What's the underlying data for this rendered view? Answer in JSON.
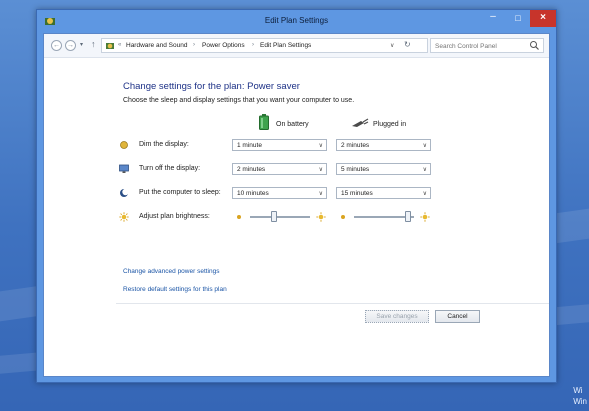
{
  "window": {
    "title": "Edit Plan Settings",
    "close_symbol": "×",
    "min_symbol": "–",
    "max_symbol": "□"
  },
  "nav": {
    "back_symbol": "←",
    "forward_symbol": "→",
    "recent_symbol": "▾",
    "up_symbol": "↑",
    "prefix_symbol": "«",
    "breadcrumbs": [
      "Hardware and Sound",
      "Power Options",
      "Edit Plan Settings"
    ],
    "breadcrumb_separator": "›",
    "dropdown_symbol": "∨",
    "refresh_symbol": "↻",
    "search_placeholder": "Search Control Panel"
  },
  "content": {
    "heading": "Change settings for the plan: Power saver",
    "subheading": "Choose the sleep and display settings that you want your computer to use.",
    "columns": {
      "battery": "On battery",
      "plugged": "Plugged in"
    },
    "rows": [
      {
        "label": "Dim the display:",
        "battery": "1 minute",
        "plugged": "2 minutes"
      },
      {
        "label": "Turn off the display:",
        "battery": "2 minutes",
        "plugged": "5 minutes"
      },
      {
        "label": "Put the computer to sleep:",
        "battery": "10 minutes",
        "plugged": "15 minutes"
      }
    ],
    "brightness": {
      "label": "Adjust plan brightness:",
      "battery_level": 0.4,
      "plugged_level": 0.9
    },
    "select_arrow": "∨",
    "links": {
      "advanced": "Change advanced power settings",
      "restore": "Restore default settings for this plan"
    },
    "buttons": {
      "save": "Save changes",
      "cancel": "Cancel"
    }
  },
  "desktop": {
    "text_line1": "Wi",
    "text_line2": "Win"
  },
  "colors": {
    "heading": "#1e3287",
    "link": "#1b55a6",
    "titlebar": "#5e97e2",
    "close_button": "#c7342b",
    "battery_green": "#3fa34d"
  }
}
